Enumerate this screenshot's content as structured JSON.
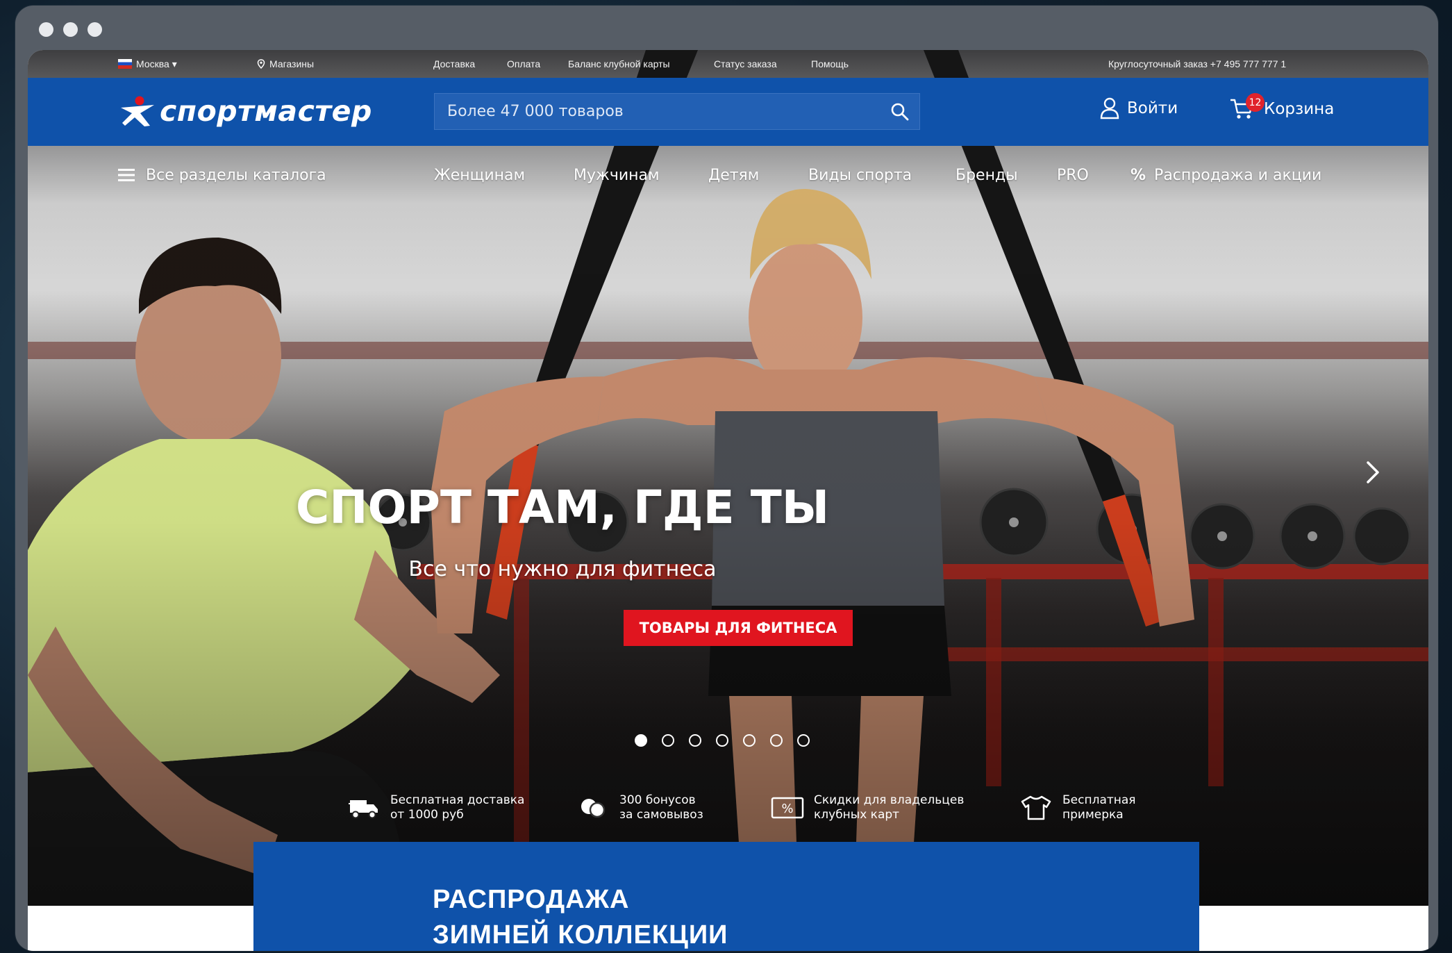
{
  "topbar": {
    "city": "Москва",
    "stores": "Магазины",
    "links": [
      "Доставка",
      "Оплата",
      "Баланс клубной карты",
      "Статус заказа",
      "Помощь"
    ],
    "phone": "Круглосуточный заказ  +7 495 777 777 1"
  },
  "header": {
    "logo_text": "спортмастер",
    "search_placeholder": "Более 47 000 товаров",
    "login_label": "Войти",
    "cart_label": "Корзина",
    "cart_count": "12"
  },
  "nav": {
    "catalog_label": "Все разделы каталога",
    "items": [
      "Женщинам",
      "Мужчинам",
      "Детям",
      "Виды спорта",
      "Бренды",
      "PRO"
    ],
    "sale_label": "Распродажа и акции",
    "sale_symbol": "%"
  },
  "hero": {
    "headline": "СПОРТ ТАМ, ГДЕ ТЫ",
    "subline": "Все что нужно для фитнеса",
    "cta_label": "ТОВАРЫ ДЛЯ ФИТНЕСА",
    "slides_count": 7,
    "active_slide": 1
  },
  "features": [
    {
      "icon": "truck-icon",
      "line1": "Бесплатная доставка",
      "line2": "от 1000 руб"
    },
    {
      "icon": "coins-icon",
      "line1": "300 бонусов",
      "line2": "за самовывоз"
    },
    {
      "icon": "discount-card-icon",
      "line1": "Скидки для владельцев",
      "line2": "клубных карт"
    },
    {
      "icon": "tshirt-icon",
      "line1": "Бесплатная",
      "line2": "примерка"
    }
  ],
  "banner": {
    "line1": "РАСПРОДАЖА",
    "line2": "ЗИМНЕЙ КОЛЛЕКЦИИ"
  },
  "colors": {
    "brand_blue": "#0f52aa",
    "accent_red": "#e0151f",
    "window_chrome": "#565d66"
  }
}
